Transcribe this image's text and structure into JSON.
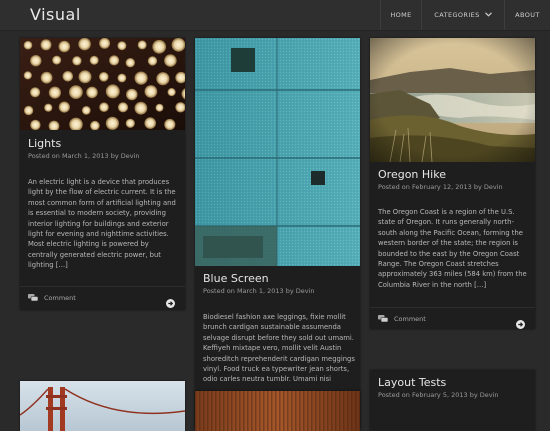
{
  "site": {
    "title": "Visual"
  },
  "nav": {
    "items": [
      {
        "label": "HOME"
      },
      {
        "label": "CATEGORIES"
      },
      {
        "label": "ABOUT"
      }
    ]
  },
  "posts": [
    {
      "title": "Lights",
      "meta": "Posted on March 1, 2013 by Devin",
      "excerpt": "An electric light is a device that produces light by the flow of electric current. It is the most common form of artificial lighting and is essential to modern society, providing interior lighting for buildings and exterior light for evening and nighttime activities. Most electric lighting is powered by centrally generated electric power, but lighting […]",
      "comment_label": "Comment"
    },
    {
      "title": "Blue Screen",
      "meta": "Posted on March 1, 2013 by Devin",
      "excerpt": "Biodiesel fashion axe leggings, fixie mollit brunch cardigan sustainable assumenda selvage disrupt before they sold out umami. Keffiyeh mixtape vero, mollit velit Austin shoreditch reprehenderit cardigan meggings vinyl. Food truck ea typewriter jean shorts, odio carles neutra tumblr. Umami nisi"
    },
    {
      "title": "Oregon Hike",
      "meta": "Posted on February 12, 2013 by Devin",
      "excerpt": "The Oregon Coast is a region of the U.S. state of Oregon. It runs generally north-south along the Pacific Ocean, forming the western border of the state; the region is bounded to the east by the Oregon Coast Range. The Oregon Coast stretches approximately 363 miles (584 km) from the Columbia River in the north […]",
      "comment_label": "Comment"
    },
    {
      "title": "Layout Tests",
      "meta": "Posted on February 5, 2013 by Devin"
    }
  ],
  "icons": {
    "comment": "comment-bubbles-icon",
    "more": "arrow-circle-right-icon",
    "chevron": "chevron-down-icon"
  },
  "colors": {
    "page_bg": "#2a2a2a",
    "card_bg": "#1e1e1e",
    "header_bg": "#2f2f2f"
  }
}
